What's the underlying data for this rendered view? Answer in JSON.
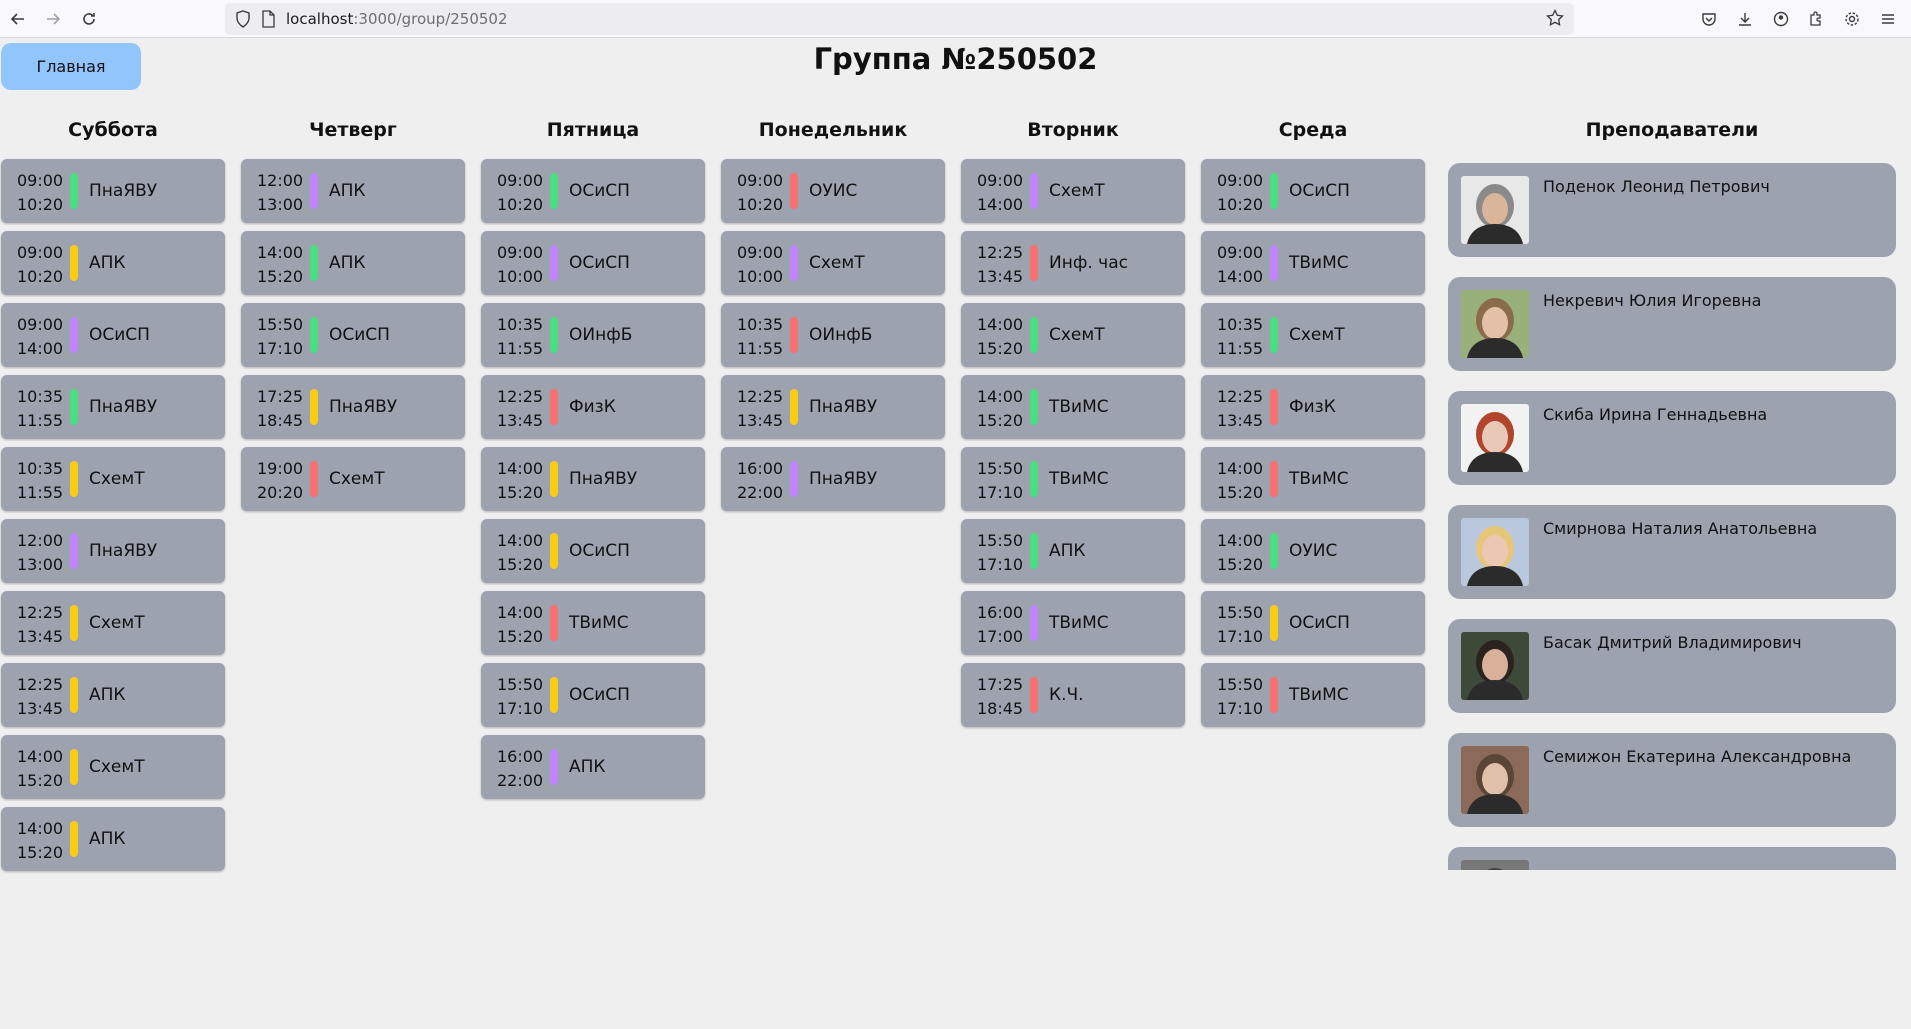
{
  "browser": {
    "url_host": "localhost",
    "url_rest": ":3000/group/250502"
  },
  "page": {
    "home_label": "Главная",
    "title": "Группа №250502"
  },
  "colors": {
    "green": "#4ade80",
    "yellow": "#facc15",
    "purple": "#c084fc",
    "red": "#f87171",
    "card": "#9ca3af",
    "home_button": "#93c5fd"
  },
  "days": [
    {
      "title": "Суббота",
      "lessons": [
        {
          "start": "09:00",
          "end": "10:20",
          "subject": "ПнаЯВУ",
          "color": "green"
        },
        {
          "start": "09:00",
          "end": "10:20",
          "subject": "АПК",
          "color": "yellow"
        },
        {
          "start": "09:00",
          "end": "14:00",
          "subject": "ОСиСП",
          "color": "purple"
        },
        {
          "start": "10:35",
          "end": "11:55",
          "subject": "ПнаЯВУ",
          "color": "green"
        },
        {
          "start": "10:35",
          "end": "11:55",
          "subject": "СхемТ",
          "color": "yellow"
        },
        {
          "start": "12:00",
          "end": "13:00",
          "subject": "ПнаЯВУ",
          "color": "purple"
        },
        {
          "start": "12:25",
          "end": "13:45",
          "subject": "СхемТ",
          "color": "yellow"
        },
        {
          "start": "12:25",
          "end": "13:45",
          "subject": "АПК",
          "color": "yellow"
        },
        {
          "start": "14:00",
          "end": "15:20",
          "subject": "СхемТ",
          "color": "yellow"
        },
        {
          "start": "14:00",
          "end": "15:20",
          "subject": "АПК",
          "color": "yellow"
        }
      ]
    },
    {
      "title": "Четверг",
      "lessons": [
        {
          "start": "12:00",
          "end": "13:00",
          "subject": "АПК",
          "color": "purple"
        },
        {
          "start": "14:00",
          "end": "15:20",
          "subject": "АПК",
          "color": "green"
        },
        {
          "start": "15:50",
          "end": "17:10",
          "subject": "ОСиСП",
          "color": "green"
        },
        {
          "start": "17:25",
          "end": "18:45",
          "subject": "ПнаЯВУ",
          "color": "yellow"
        },
        {
          "start": "19:00",
          "end": "20:20",
          "subject": "СхемТ",
          "color": "red"
        }
      ]
    },
    {
      "title": "Пятница",
      "lessons": [
        {
          "start": "09:00",
          "end": "10:20",
          "subject": "ОСиСП",
          "color": "green"
        },
        {
          "start": "09:00",
          "end": "10:00",
          "subject": "ОСиСП",
          "color": "purple"
        },
        {
          "start": "10:35",
          "end": "11:55",
          "subject": "ОИнфБ",
          "color": "green"
        },
        {
          "start": "12:25",
          "end": "13:45",
          "subject": "ФизК",
          "color": "red"
        },
        {
          "start": "14:00",
          "end": "15:20",
          "subject": "ПнаЯВУ",
          "color": "yellow"
        },
        {
          "start": "14:00",
          "end": "15:20",
          "subject": "ОСиСП",
          "color": "yellow"
        },
        {
          "start": "14:00",
          "end": "15:20",
          "subject": "ТВиМС",
          "color": "red"
        },
        {
          "start": "15:50",
          "end": "17:10",
          "subject": "ОСиСП",
          "color": "yellow"
        },
        {
          "start": "16:00",
          "end": "22:00",
          "subject": "АПК",
          "color": "purple"
        }
      ]
    },
    {
      "title": "Понедельник",
      "lessons": [
        {
          "start": "09:00",
          "end": "10:20",
          "subject": "ОУИС",
          "color": "red"
        },
        {
          "start": "09:00",
          "end": "10:00",
          "subject": "СхемТ",
          "color": "purple"
        },
        {
          "start": "10:35",
          "end": "11:55",
          "subject": "ОИнфБ",
          "color": "red"
        },
        {
          "start": "12:25",
          "end": "13:45",
          "subject": "ПнаЯВУ",
          "color": "yellow"
        },
        {
          "start": "16:00",
          "end": "22:00",
          "subject": "ПнаЯВУ",
          "color": "purple"
        }
      ]
    },
    {
      "title": "Вторник",
      "lessons": [
        {
          "start": "09:00",
          "end": "14:00",
          "subject": "СхемТ",
          "color": "purple"
        },
        {
          "start": "12:25",
          "end": "13:45",
          "subject": "Инф. час",
          "color": "red"
        },
        {
          "start": "14:00",
          "end": "15:20",
          "subject": "СхемТ",
          "color": "green"
        },
        {
          "start": "14:00",
          "end": "15:20",
          "subject": "ТВиМС",
          "color": "green"
        },
        {
          "start": "15:50",
          "end": "17:10",
          "subject": "ТВиМС",
          "color": "green"
        },
        {
          "start": "15:50",
          "end": "17:10",
          "subject": "АПК",
          "color": "green"
        },
        {
          "start": "16:00",
          "end": "17:00",
          "subject": "ТВиМС",
          "color": "purple"
        },
        {
          "start": "17:25",
          "end": "18:45",
          "subject": "К.Ч.",
          "color": "red"
        }
      ]
    },
    {
      "title": "Среда",
      "lessons": [
        {
          "start": "09:00",
          "end": "10:20",
          "subject": "ОСиСП",
          "color": "green"
        },
        {
          "start": "09:00",
          "end": "14:00",
          "subject": "ТВиМС",
          "color": "purple"
        },
        {
          "start": "10:35",
          "end": "11:55",
          "subject": "СхемТ",
          "color": "green"
        },
        {
          "start": "12:25",
          "end": "13:45",
          "subject": "ФизК",
          "color": "red"
        },
        {
          "start": "14:00",
          "end": "15:20",
          "subject": "ТВиМС",
          "color": "red"
        },
        {
          "start": "14:00",
          "end": "15:20",
          "subject": "ОУИС",
          "color": "green"
        },
        {
          "start": "15:50",
          "end": "17:10",
          "subject": "ОСиСП",
          "color": "yellow"
        },
        {
          "start": "15:50",
          "end": "17:10",
          "subject": "ТВиМС",
          "color": "red"
        }
      ]
    }
  ],
  "teachers": {
    "title": "Преподаватели",
    "items": [
      {
        "name": "Поденок Леонид Петрович",
        "hair": "#8a8a8a",
        "skin": "#d9b59a",
        "bg": "#e8e8e8"
      },
      {
        "name": "Некревич Юлия Игоревна",
        "hair": "#8a6b4a",
        "skin": "#e2c1a8",
        "bg": "#9ab07a"
      },
      {
        "name": "Скиба Ирина Геннадьевна",
        "hair": "#b0442c",
        "skin": "#eac8b8",
        "bg": "#f2f2f2"
      },
      {
        "name": "Смирнова Наталия Анатольевна",
        "hair": "#e6c77a",
        "skin": "#ecc8b4",
        "bg": "#b9c8dc"
      },
      {
        "name": "Басак Дмитрий Владимирович",
        "hair": "#2a2320",
        "skin": "#d9b09a",
        "bg": "#3d4a3a"
      },
      {
        "name": "Семижон Екатерина Александровна",
        "hair": "#5a4636",
        "skin": "#e0c0a8",
        "bg": "#8c6a5a"
      },
      {
        "name": "",
        "hair": "#444",
        "skin": "#ccc",
        "bg": "#777"
      }
    ]
  }
}
